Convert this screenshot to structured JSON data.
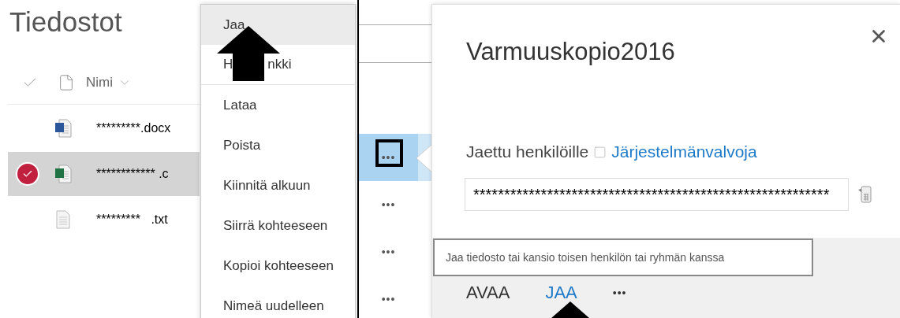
{
  "files_panel": {
    "title": "Tiedostot",
    "column": "Nimi",
    "rows": [
      {
        "name": "*********.docx",
        "kind": "word",
        "selected": false
      },
      {
        "name": "************ .c",
        "kind": "excel",
        "selected": true
      },
      {
        "name": "*********   .txt",
        "kind": "text",
        "selected": false
      }
    ]
  },
  "context_menu": {
    "items": [
      {
        "label": "Jaa",
        "selected": true,
        "divider_after": false
      },
      {
        "label_parts": [
          "H",
          "nkki"
        ],
        "selected": false,
        "divider_after": true
      },
      {
        "label": "Lataa",
        "selected": false,
        "divider_after": false
      },
      {
        "label": "Poista",
        "selected": false,
        "divider_after": false
      },
      {
        "label": "Kiinnitä alkuun",
        "selected": false,
        "divider_after": false
      },
      {
        "label": "Siirrä kohteeseen",
        "selected": false,
        "divider_after": false
      },
      {
        "label": "Kopioi kohteeseen",
        "selected": false,
        "divider_after": false
      },
      {
        "label": "Nimeä uudelleen",
        "selected": false,
        "divider_after": false
      }
    ]
  },
  "list": {
    "rows": [
      {
        "more": "•••",
        "selected": true
      },
      {
        "more": "•••",
        "selected": false
      },
      {
        "more": "•••",
        "selected": false
      },
      {
        "more": "•••",
        "selected": false
      }
    ]
  },
  "dialog": {
    "title": "Varmuuskopio2016",
    "shared_label": "Jaettu henkilöille",
    "shared_with": "Järjestelmänvalvoja",
    "link": "**********************************************************",
    "tooltip": "Jaa tiedosto tai kansio toisen henkilön tai ryhmän kanssa",
    "actions": [
      {
        "label": "AVAA",
        "selected": false
      },
      {
        "label": "JAA",
        "selected": true
      },
      {
        "label": "•••",
        "selected": false
      }
    ]
  }
}
